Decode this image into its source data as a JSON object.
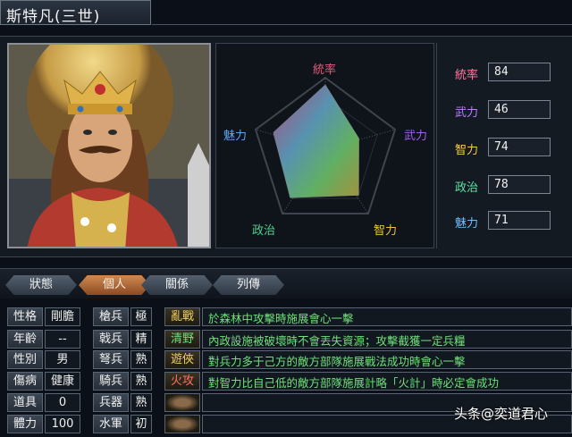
{
  "header": {
    "title": "斯特凡(三世)"
  },
  "radar": {
    "labels": {
      "top": "統率",
      "right": "武力",
      "bottom_right": "智力",
      "bottom_left": "政治",
      "left": "魅力"
    },
    "colors": {
      "top": "#e05a7a",
      "right": "#a35cf0",
      "bottom_right": "#f0c23a",
      "bottom_left": "#4fd090",
      "left": "#5aa8f0"
    }
  },
  "stats": [
    {
      "label": "統率",
      "value": "84",
      "color": "#ff7aa0"
    },
    {
      "label": "武力",
      "value": "46",
      "color": "#c07cff"
    },
    {
      "label": "智力",
      "value": "74",
      "color": "#f2d04a"
    },
    {
      "label": "政治",
      "value": "78",
      "color": "#5fe0a0"
    },
    {
      "label": "魅力",
      "value": "71",
      "color": "#6cc0ff"
    }
  ],
  "tabs": [
    {
      "label": "狀態",
      "active": false
    },
    {
      "label": "個人",
      "active": true
    },
    {
      "label": "關係",
      "active": false
    },
    {
      "label": "列傳",
      "active": false
    }
  ],
  "personal": [
    {
      "label": "性格",
      "value": "剛膽"
    },
    {
      "label": "年齡",
      "value": "--"
    },
    {
      "label": "性別",
      "value": "男"
    },
    {
      "label": "傷病",
      "value": "健康"
    },
    {
      "label": "道具",
      "value": "0"
    },
    {
      "label": "體力",
      "value": "100"
    }
  ],
  "aptitude": [
    {
      "label": "槍兵",
      "value": "極"
    },
    {
      "label": "戟兵",
      "value": "精"
    },
    {
      "label": "弩兵",
      "value": "熟"
    },
    {
      "label": "騎兵",
      "value": "熟"
    },
    {
      "label": "兵器",
      "value": "熟"
    },
    {
      "label": "水軍",
      "value": "初"
    }
  ],
  "skills": [
    {
      "name": "亂戰",
      "desc": "於森林中攻擊時施展會心一擊",
      "color": "#f0d060"
    },
    {
      "name": "清野",
      "desc": "內政設施被破壞時不會丟失資源；攻擊截獲一定兵糧",
      "color": "#6fe07a"
    },
    {
      "name": "遊俠",
      "desc": "對兵力多于己方的敵方部隊施展戰法成功時會心一擊",
      "color": "#f0d060"
    },
    {
      "name": "火攻",
      "desc": "對智力比自己低的敵方部隊施展計略「火計」時必定會成功",
      "color": "#ff7060"
    },
    {
      "name": "",
      "desc": ""
    },
    {
      "name": "",
      "desc": ""
    }
  ],
  "watermark": "头条@奕道君心"
}
